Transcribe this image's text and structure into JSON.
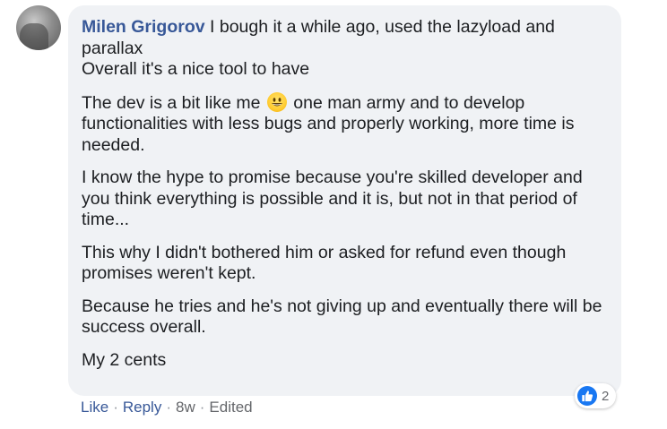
{
  "comment": {
    "author": "Milen Grigorov",
    "first_line_text": " I bough it a while ago, used the lazyload and",
    "first_para_lines": [
      "parallax",
      "Overall it's a nice tool to have"
    ],
    "para2": {
      "before_emoji": "The dev is a bit like me",
      "emoji": "grinning-face-emoji",
      "after_emoji": " one man army and to develop",
      "lines": [
        "functionalities with less bugs and properly working, more time is",
        "needed."
      ]
    },
    "para3": [
      "I know the hype to promise because you're skilled developer and",
      "you think everything is possible and it is, but not in that period of",
      "time..."
    ],
    "para4": [
      "This why I didn't bothered him or asked for refund even though",
      "promises weren't kept."
    ],
    "para5": [
      "Because he tries and he's not giving up and eventually there will be",
      "success overall."
    ],
    "para6": [
      "My 2 cents"
    ]
  },
  "reactions": {
    "icon": "like-icon",
    "count": "2",
    "color": "#1877f2"
  },
  "actions": {
    "like": "Like",
    "separator": "·",
    "reply": "Reply",
    "time": "8w",
    "edited": "Edited"
  },
  "colors": {
    "bubble": "#f0f2f5",
    "author": "#385898",
    "text": "#1c1e21",
    "meta": "#65676b"
  }
}
